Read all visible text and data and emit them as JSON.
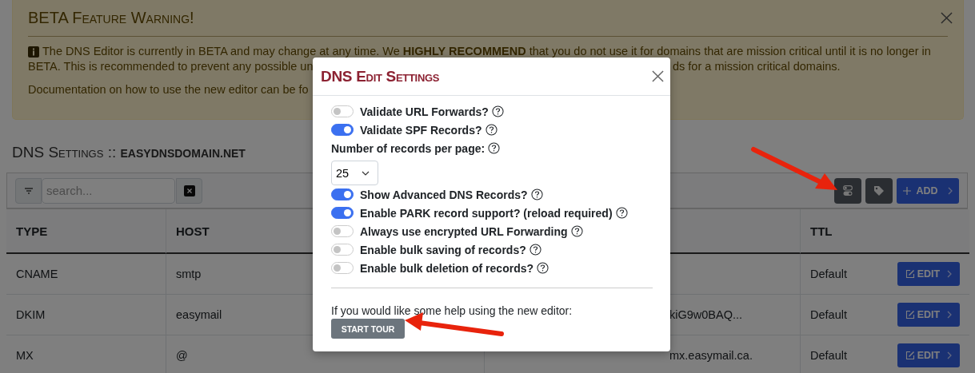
{
  "alert": {
    "title": "BETA Feature Warning!",
    "line_1": "The DNS Editor is currently in BETA and may change at any time. We **HIGHLY RECOMMEND** that you do not use it for domains that are mission critical until it is no longer in",
    "line_2_left": "BETA. This is recommended to prevent any possible un",
    "line_2_right": "ds for a mission critical domains.",
    "line_3_left": "Documentation on how to use the new editor can be fo"
  },
  "heading": {
    "title": "DNS Settings ::",
    "domain": "EASYDNSDOMAIN.NET"
  },
  "toolbar": {
    "search": {
      "placeholder": "search..."
    },
    "add_button": "ADD"
  },
  "table": {
    "columns": {
      "type": "TYPE",
      "host": "HOST",
      "ttl": "TTL"
    },
    "rows": [
      {
        "type": "CNAME",
        "host": "smtp",
        "ttl": "Default",
        "action": "EDIT"
      },
      {
        "type": "DKIM",
        "host": "easymail",
        "column_3": "kiG9w0BAQ...",
        "ttl": "Default",
        "action": "EDIT"
      },
      {
        "type": "MX",
        "host": "@",
        "column_3": "mx.easymail.ca.",
        "ttl": "Default",
        "action": "EDIT"
      }
    ]
  },
  "modal": {
    "title": "DNS Edit Settings",
    "settings": [
      {
        "kind": "toggle",
        "label": "Validate URL Forwards?",
        "on": false
      },
      {
        "kind": "toggle",
        "label": "Validate SPF Records?",
        "on": true
      },
      {
        "kind": "select",
        "label": "Number of records per page:",
        "value": "25"
      },
      {
        "kind": "toggle",
        "label": "Show Advanced DNS Records?",
        "on": true
      },
      {
        "kind": "toggle",
        "label": "Enable PARK record support? (reload required)",
        "on": true
      },
      {
        "kind": "toggle",
        "label": "Always use encrypted URL Forwarding",
        "on": false
      },
      {
        "kind": "toggle",
        "label": "Enable bulk saving of records?",
        "on": false
      },
      {
        "kind": "toggle",
        "label": "Enable bulk deletion of records?",
        "on": false
      }
    ],
    "help_text": "If you would like some help using the new editor:",
    "tour_button": "START TOUR"
  }
}
